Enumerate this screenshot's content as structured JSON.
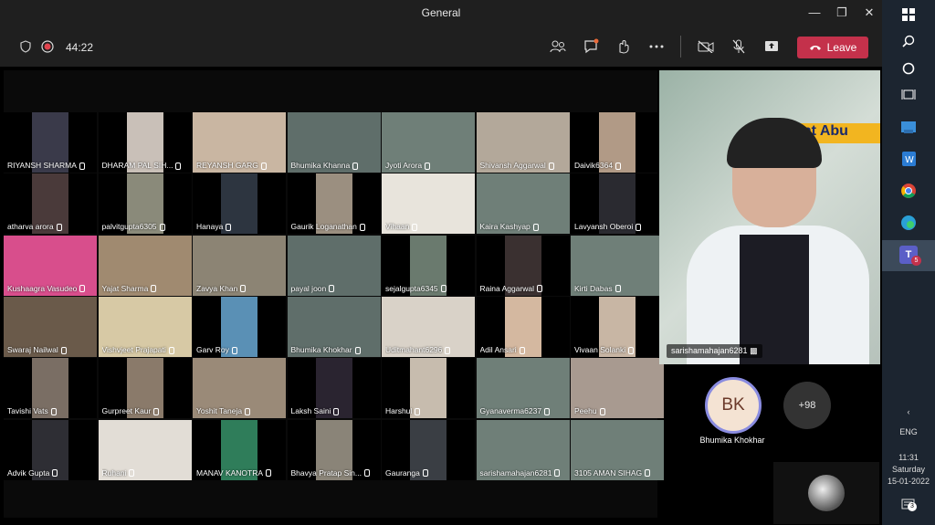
{
  "window": {
    "title": "General"
  },
  "toolbar": {
    "timer": "44:22",
    "leave_label": "Leave"
  },
  "tiles": [
    {
      "name": "RIYANSH  SHARMA",
      "bg": "#3a3a4a",
      "fit": "narrow"
    },
    {
      "name": "DHARAM PAL SIH...",
      "bg": "#c9c0b8",
      "fit": "narrow"
    },
    {
      "name": "REYANSH  GARG",
      "bg": "#c9b6a2",
      "fit": "full"
    },
    {
      "name": "Bhumika  Khanna",
      "bg": "#5f6e6a",
      "fit": "full"
    },
    {
      "name": "Jyoti Arora",
      "bg": "#6f7f78",
      "fit": "full"
    },
    {
      "name": "Shivansh  Aggarwal",
      "bg": "#b3a89a",
      "fit": "full"
    },
    {
      "name": "Daivik6364",
      "bg": "#b19a86",
      "fit": "narrow"
    },
    {
      "name": "atharva arora",
      "bg": "#4a3a3a",
      "fit": "narrow"
    },
    {
      "name": "palvitgupta6305",
      "bg": "#8a8a7a",
      "fit": "narrow"
    },
    {
      "name": "Hanaya",
      "bg": "#2d3540",
      "fit": "narrow"
    },
    {
      "name": "Gaurik Loganathan",
      "bg": "#9b8f80",
      "fit": "narrow"
    },
    {
      "name": "Vihaan",
      "bg": "#e8e4dc",
      "fit": "full"
    },
    {
      "name": "Kaira Kashyap",
      "bg": "#6f7f78",
      "fit": "full"
    },
    {
      "name": "Lavyansh Oberoi",
      "bg": "#2a2a30",
      "fit": "narrow"
    },
    {
      "name": "Kushaagra Vasudeo",
      "bg": "#d84e8c",
      "fit": "full"
    },
    {
      "name": "Yajat Sharma",
      "bg": "#a08a70",
      "fit": "full"
    },
    {
      "name": "Zavya Khan",
      "bg": "#8c8474",
      "fit": "full"
    },
    {
      "name": "payal joon",
      "bg": "#5f6e6a",
      "fit": "full"
    },
    {
      "name": "sejalgupta6345",
      "bg": "#6a7a6e",
      "fit": "narrow"
    },
    {
      "name": "Raina  Aggarwal",
      "bg": "#3a3030",
      "fit": "narrow"
    },
    {
      "name": "Kirti Dabas",
      "bg": "#6f7f78",
      "fit": "full"
    },
    {
      "name": "Swaraj Nailwal",
      "bg": "#6a5a4a",
      "fit": "full"
    },
    {
      "name": "Vishvjeet Prajapati",
      "bg": "#d7c9a5",
      "fit": "full"
    },
    {
      "name": "Garv Roy",
      "bg": "#5a90b5",
      "fit": "narrow"
    },
    {
      "name": "Bhumika Khokhar",
      "bg": "#5f6e6a",
      "fit": "full"
    },
    {
      "name": "Uditmahant6296",
      "bg": "#d9d2c8",
      "fit": "full"
    },
    {
      "name": "Adil  Ansari",
      "bg": "#d4b8a0",
      "fit": "narrow"
    },
    {
      "name": "Vivaan Solanki",
      "bg": "#c8b6a4",
      "fit": "narrow"
    },
    {
      "name": "Tavishi Vats",
      "bg": "#7a6e64",
      "fit": "narrow"
    },
    {
      "name": "Gurpreet Kaur",
      "bg": "#8a7a6a",
      "fit": "narrow"
    },
    {
      "name": "Yoshit Taneja",
      "bg": "#9a8a78",
      "fit": "full"
    },
    {
      "name": "Laksh  Saini",
      "bg": "#2a2430",
      "fit": "narrow"
    },
    {
      "name": "Harshul",
      "bg": "#c7bcae",
      "fit": "narrow"
    },
    {
      "name": "Gyanaverma6237",
      "bg": "#6f7f78",
      "fit": "full"
    },
    {
      "name": "Peehu",
      "bg": "#a89a90",
      "fit": "full"
    },
    {
      "name": "Advik  Gupta",
      "bg": "#2e2e34",
      "fit": "narrow"
    },
    {
      "name": "Ruhani",
      "bg": "#e2ddd6",
      "fit": "full"
    },
    {
      "name": "MANAV  KANOTRA",
      "bg": "#2f7d5a",
      "fit": "narrow"
    },
    {
      "name": "Bhavya  Pratap Sin...",
      "bg": "#8a8478",
      "fit": "narrow"
    },
    {
      "name": "Gauranga",
      "bg": "#3a3e44",
      "fit": "narrow"
    },
    {
      "name": "sarishamahajan6281",
      "bg": "#6f7f78",
      "fit": "full"
    },
    {
      "name": "3105  AMAN SIHAG",
      "bg": "#6f7f78",
      "fit": "full"
    }
  ],
  "speaker": {
    "name": "sarishamahajan6281",
    "banner": "Mount Abu"
  },
  "pinned": {
    "initials": "BK",
    "name": "Bhumika Khokhar",
    "more": "+98"
  },
  "taskbar": {
    "lang": "ENG",
    "time": "11:31",
    "day": "Saturday",
    "date": "15-01-2022",
    "badge": "5",
    "notif": "3"
  },
  "colors": {
    "leave": "#c4314b",
    "teams": "#5b5fc7"
  }
}
